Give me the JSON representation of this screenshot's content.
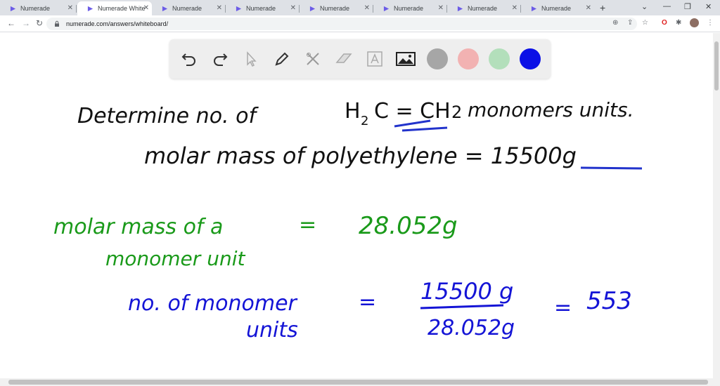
{
  "tabs": [
    {
      "label": "Numerade"
    },
    {
      "label": "Numerade White"
    },
    {
      "label": "Numerade"
    },
    {
      "label": "Numerade"
    },
    {
      "label": "Numerade"
    },
    {
      "label": "Numerade"
    },
    {
      "label": "Numerade"
    },
    {
      "label": "Numerade"
    }
  ],
  "address": {
    "url": "numerade.com/answers/whiteboard/"
  },
  "toolbar": {
    "tools": [
      "undo-icon",
      "redo-icon",
      "select-icon",
      "pen-icon",
      "tools-icon",
      "eraser-icon",
      "text-icon",
      "image-icon"
    ],
    "colors": {
      "gray": "#a6a6a6",
      "pink": "#f2b2b2",
      "green": "#b3dfbb",
      "blue": "#0b10e6"
    }
  },
  "whiteboard": {
    "line1": "Determine no. of",
    "formula_h": "H",
    "formula_2a": "2",
    "formula_c": "C = CH",
    "formula_2b": "2",
    "line1_end": "monomers units.",
    "line2": "molar mass of polyethylene  =  15500g",
    "green1": "molar mass of a",
    "green_eq": "=",
    "green_val": "28.052g",
    "green2": "monomer unit",
    "blue1": "no. of  monomer",
    "blue_eq1": "=",
    "blue2": "units",
    "frac_num": "15500 g",
    "frac_den": "28.052g",
    "blue_eq2": "=",
    "result": "553"
  },
  "colors": {
    "ink_black": "#111111",
    "ink_green": "#1a9a1a",
    "ink_blue": "#1414d6",
    "ink_blue_under": "#2233cc"
  }
}
